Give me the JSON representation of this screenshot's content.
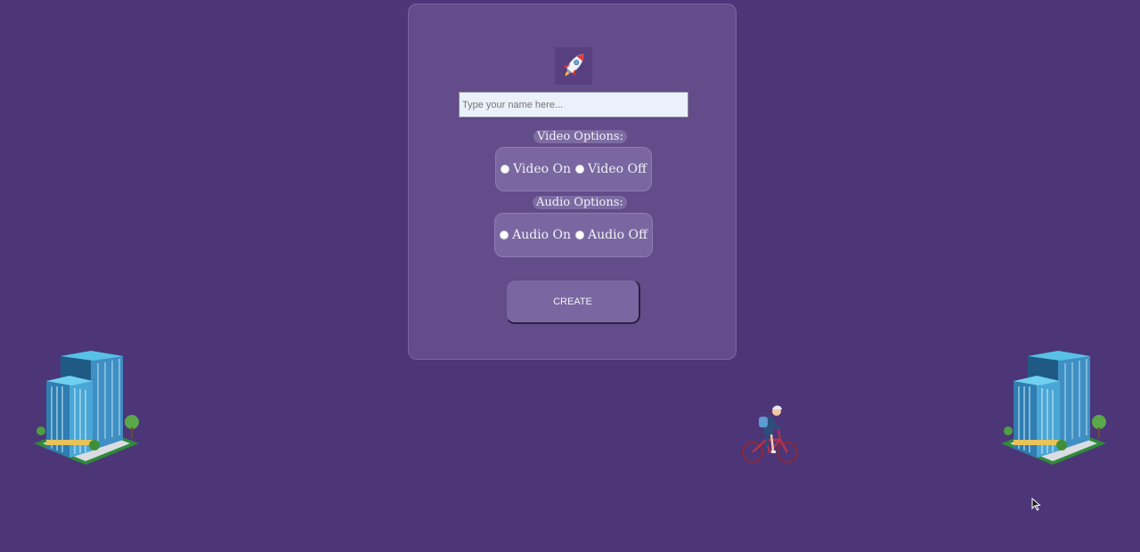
{
  "form": {
    "name_placeholder": "Type your name here...",
    "name_value": "",
    "video": {
      "label": "Video Options:",
      "on_label": "Video On",
      "off_label": "Video Off"
    },
    "audio": {
      "label": "Audio Options:",
      "on_label": "Audio On",
      "off_label": "Audio Off"
    },
    "create_label": "CREATE"
  },
  "icons": {
    "logo": "rocket-icon",
    "left_illustration": "office-building-illustration",
    "right_illustration": "office-building-illustration",
    "center_illustration": "cyclist-illustration",
    "cursor": "mouse-cursor-icon"
  },
  "colors": {
    "background": "#4c3677",
    "card": "#624c8a",
    "option_box": "#7a67a1",
    "input_bg": "#eaf1fb"
  }
}
